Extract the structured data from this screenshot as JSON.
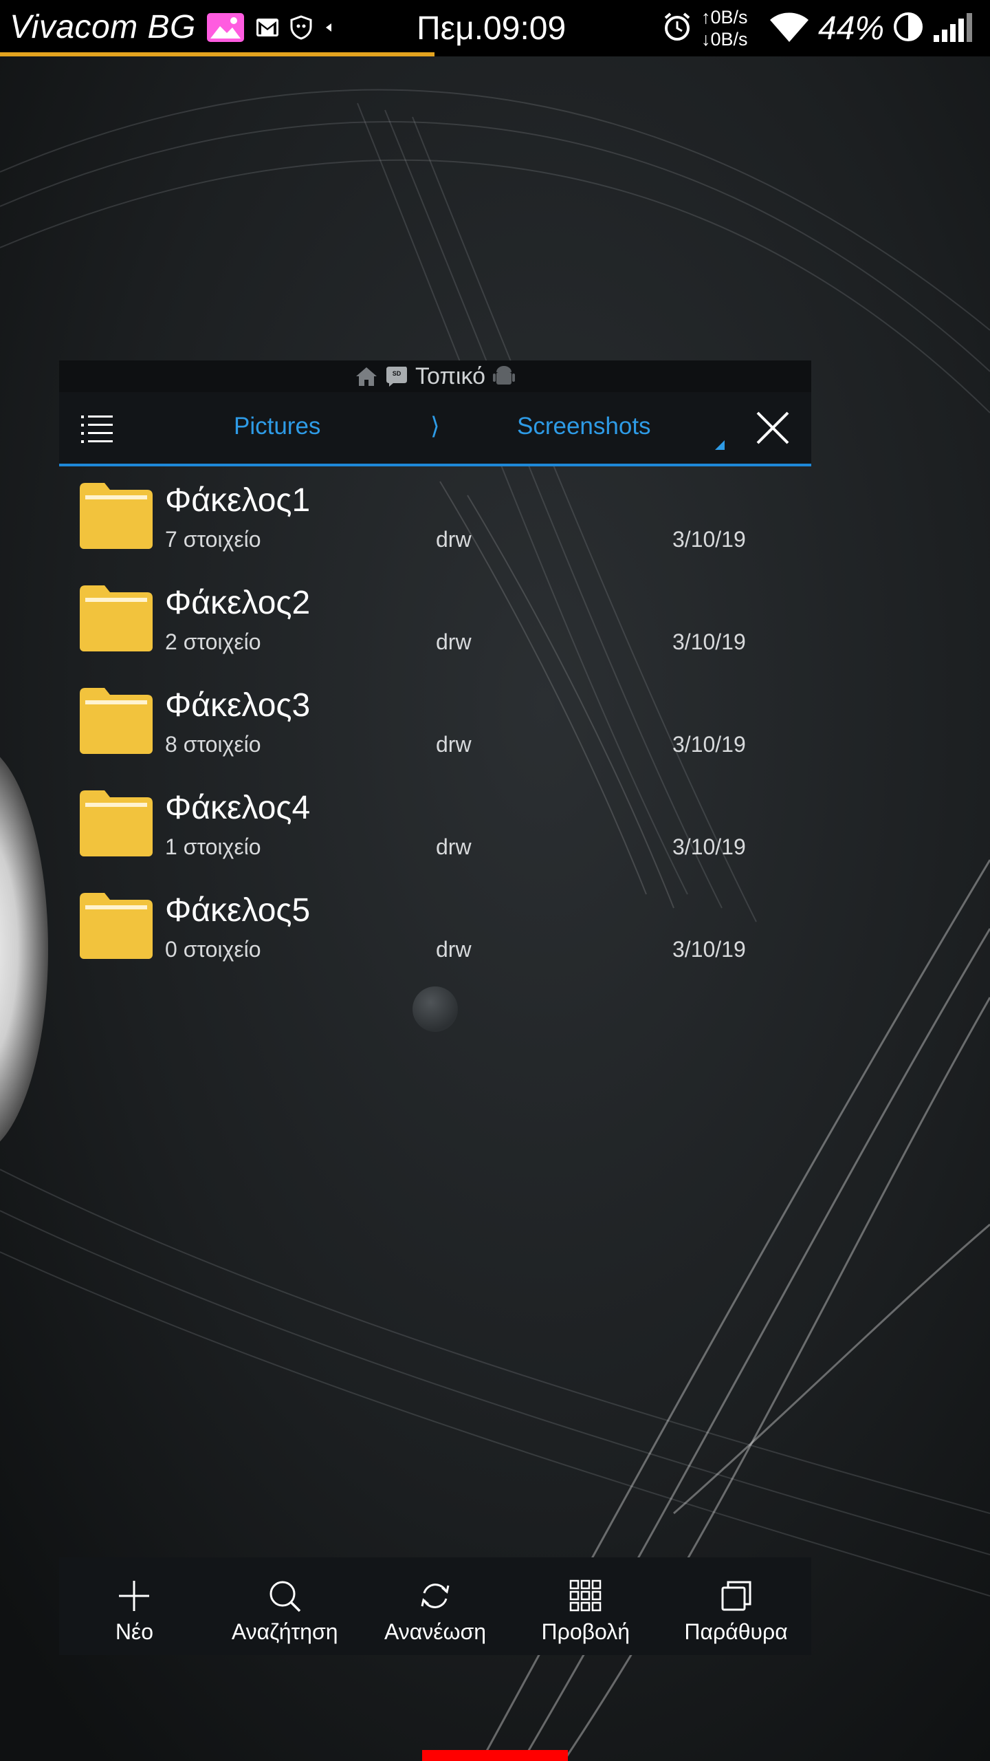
{
  "status_bar": {
    "carrier": "Vivacom BG",
    "time": "Πεμ.09:09",
    "upload_speed": "↑0B/s",
    "download_speed": "↓0B/s",
    "battery": "44%",
    "icons": [
      "image-icon",
      "gmail-icon",
      "shield-icon",
      "arrow-left-icon",
      "alarm-icon",
      "wifi-icon",
      "battery-saver-icon",
      "signal-icon"
    ]
  },
  "location_bar": {
    "label": "Τοπικό",
    "icons": [
      "home-icon",
      "sd-card-icon",
      "android-icon"
    ]
  },
  "path": {
    "crumbs": [
      "Pictures",
      "Screenshots"
    ],
    "separator": "⟩"
  },
  "files": [
    {
      "name": "Φάκελος1",
      "items": "7 στοιχείο",
      "perm": "drw",
      "date": "3/10/19"
    },
    {
      "name": "Φάκελος2",
      "items": "2 στοιχείο",
      "perm": "drw",
      "date": "3/10/19"
    },
    {
      "name": "Φάκελος3",
      "items": "8 στοιχείο",
      "perm": "drw",
      "date": "3/10/19"
    },
    {
      "name": "Φάκελος4",
      "items": "1 στοιχείο",
      "perm": "drw",
      "date": "3/10/19"
    },
    {
      "name": "Φάκελος5",
      "items": "0 στοιχείο",
      "perm": "drw",
      "date": "3/10/19"
    }
  ],
  "toolbar": {
    "new": "Νέο",
    "search": "Αναζήτηση",
    "refresh": "Ανανέωση",
    "view": "Προβολή",
    "windows": "Παράθυρα"
  },
  "colors": {
    "accent": "#2e9be6",
    "folder": "#f2c33d",
    "progress": "#e3a31f",
    "nav_indicator": "#ff0000"
  }
}
